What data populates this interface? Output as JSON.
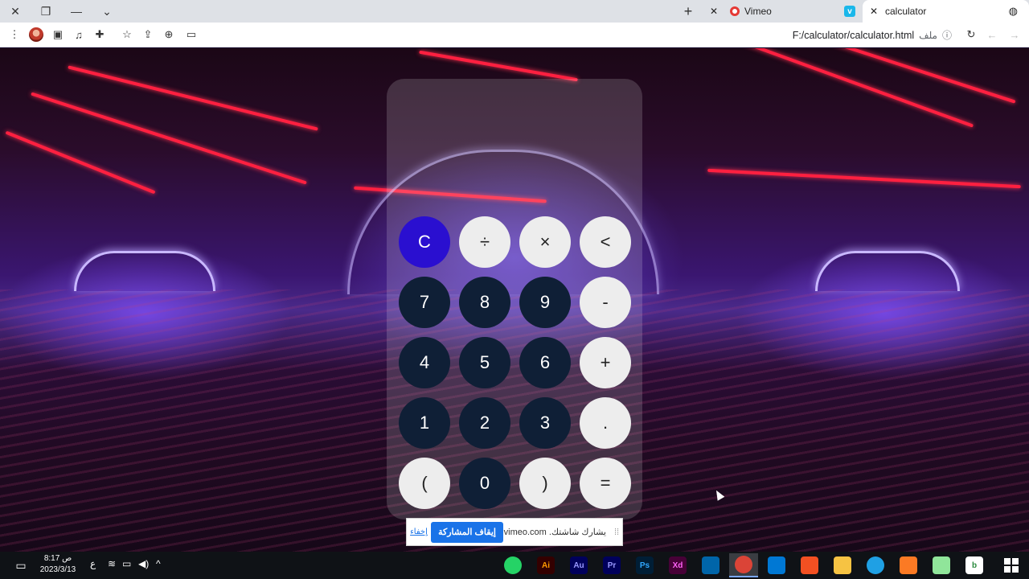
{
  "browser": {
    "tabs": [
      {
        "label": "Vimeo",
        "favicon": "vimeo-record-icon"
      },
      {
        "label": "calculator",
        "favicon": "vimeo-v-icon"
      }
    ],
    "address": {
      "url": "F:/calculator/calculator.html",
      "scheme_label": "ملف"
    }
  },
  "calculator": {
    "display": "",
    "keys": [
      [
        "C",
        "÷",
        "×",
        "<"
      ],
      [
        "7",
        "8",
        "9",
        "-"
      ],
      [
        "4",
        "5",
        "6",
        "+"
      ],
      [
        "1",
        "2",
        "3",
        "."
      ],
      [
        "(",
        "0",
        ")",
        "="
      ]
    ]
  },
  "share_bar": {
    "message": "vimeo.com .يشارك شاشتك",
    "stop_label": "إيقاف المشاركة",
    "hide_label": "إخفاء"
  },
  "taskbar": {
    "time": "8:17 ص",
    "date": "2023/3/13",
    "lang": "ع",
    "apps": [
      {
        "name": "whatsapp-icon",
        "glyph": "",
        "color": "#25d366"
      },
      {
        "name": "illustrator-icon",
        "glyph": "Ai",
        "color": "#330000",
        "fg": "#ff9a00"
      },
      {
        "name": "audition-icon",
        "glyph": "Au",
        "color": "#00005b",
        "fg": "#9999ff"
      },
      {
        "name": "premiere-icon",
        "glyph": "Pr",
        "color": "#00005b",
        "fg": "#9999ff"
      },
      {
        "name": "photoshop-icon",
        "glyph": "Ps",
        "color": "#001e36",
        "fg": "#31a8ff"
      },
      {
        "name": "xd-icon",
        "glyph": "Xd",
        "color": "#470137",
        "fg": "#ff61f6"
      },
      {
        "name": "vscode-icon",
        "glyph": "",
        "color": "#0065a9"
      },
      {
        "name": "chrome-icon",
        "glyph": "",
        "color": "#db4437"
      },
      {
        "name": "mail-icon",
        "glyph": "",
        "color": "#0078d4"
      },
      {
        "name": "store-icon",
        "glyph": "",
        "color": "#f25022"
      },
      {
        "name": "file-explorer-icon",
        "glyph": "",
        "color": "#f6c343"
      },
      {
        "name": "edge-icon",
        "glyph": "",
        "color": "#1fa0e4"
      },
      {
        "name": "xampp-icon",
        "glyph": "",
        "color": "#fb7a24"
      },
      {
        "name": "notepadpp-icon",
        "glyph": "",
        "color": "#90e59a"
      },
      {
        "name": "bandicam-icon",
        "glyph": "b",
        "color": "#ffffff",
        "fg": "#2b8a3e"
      }
    ]
  }
}
